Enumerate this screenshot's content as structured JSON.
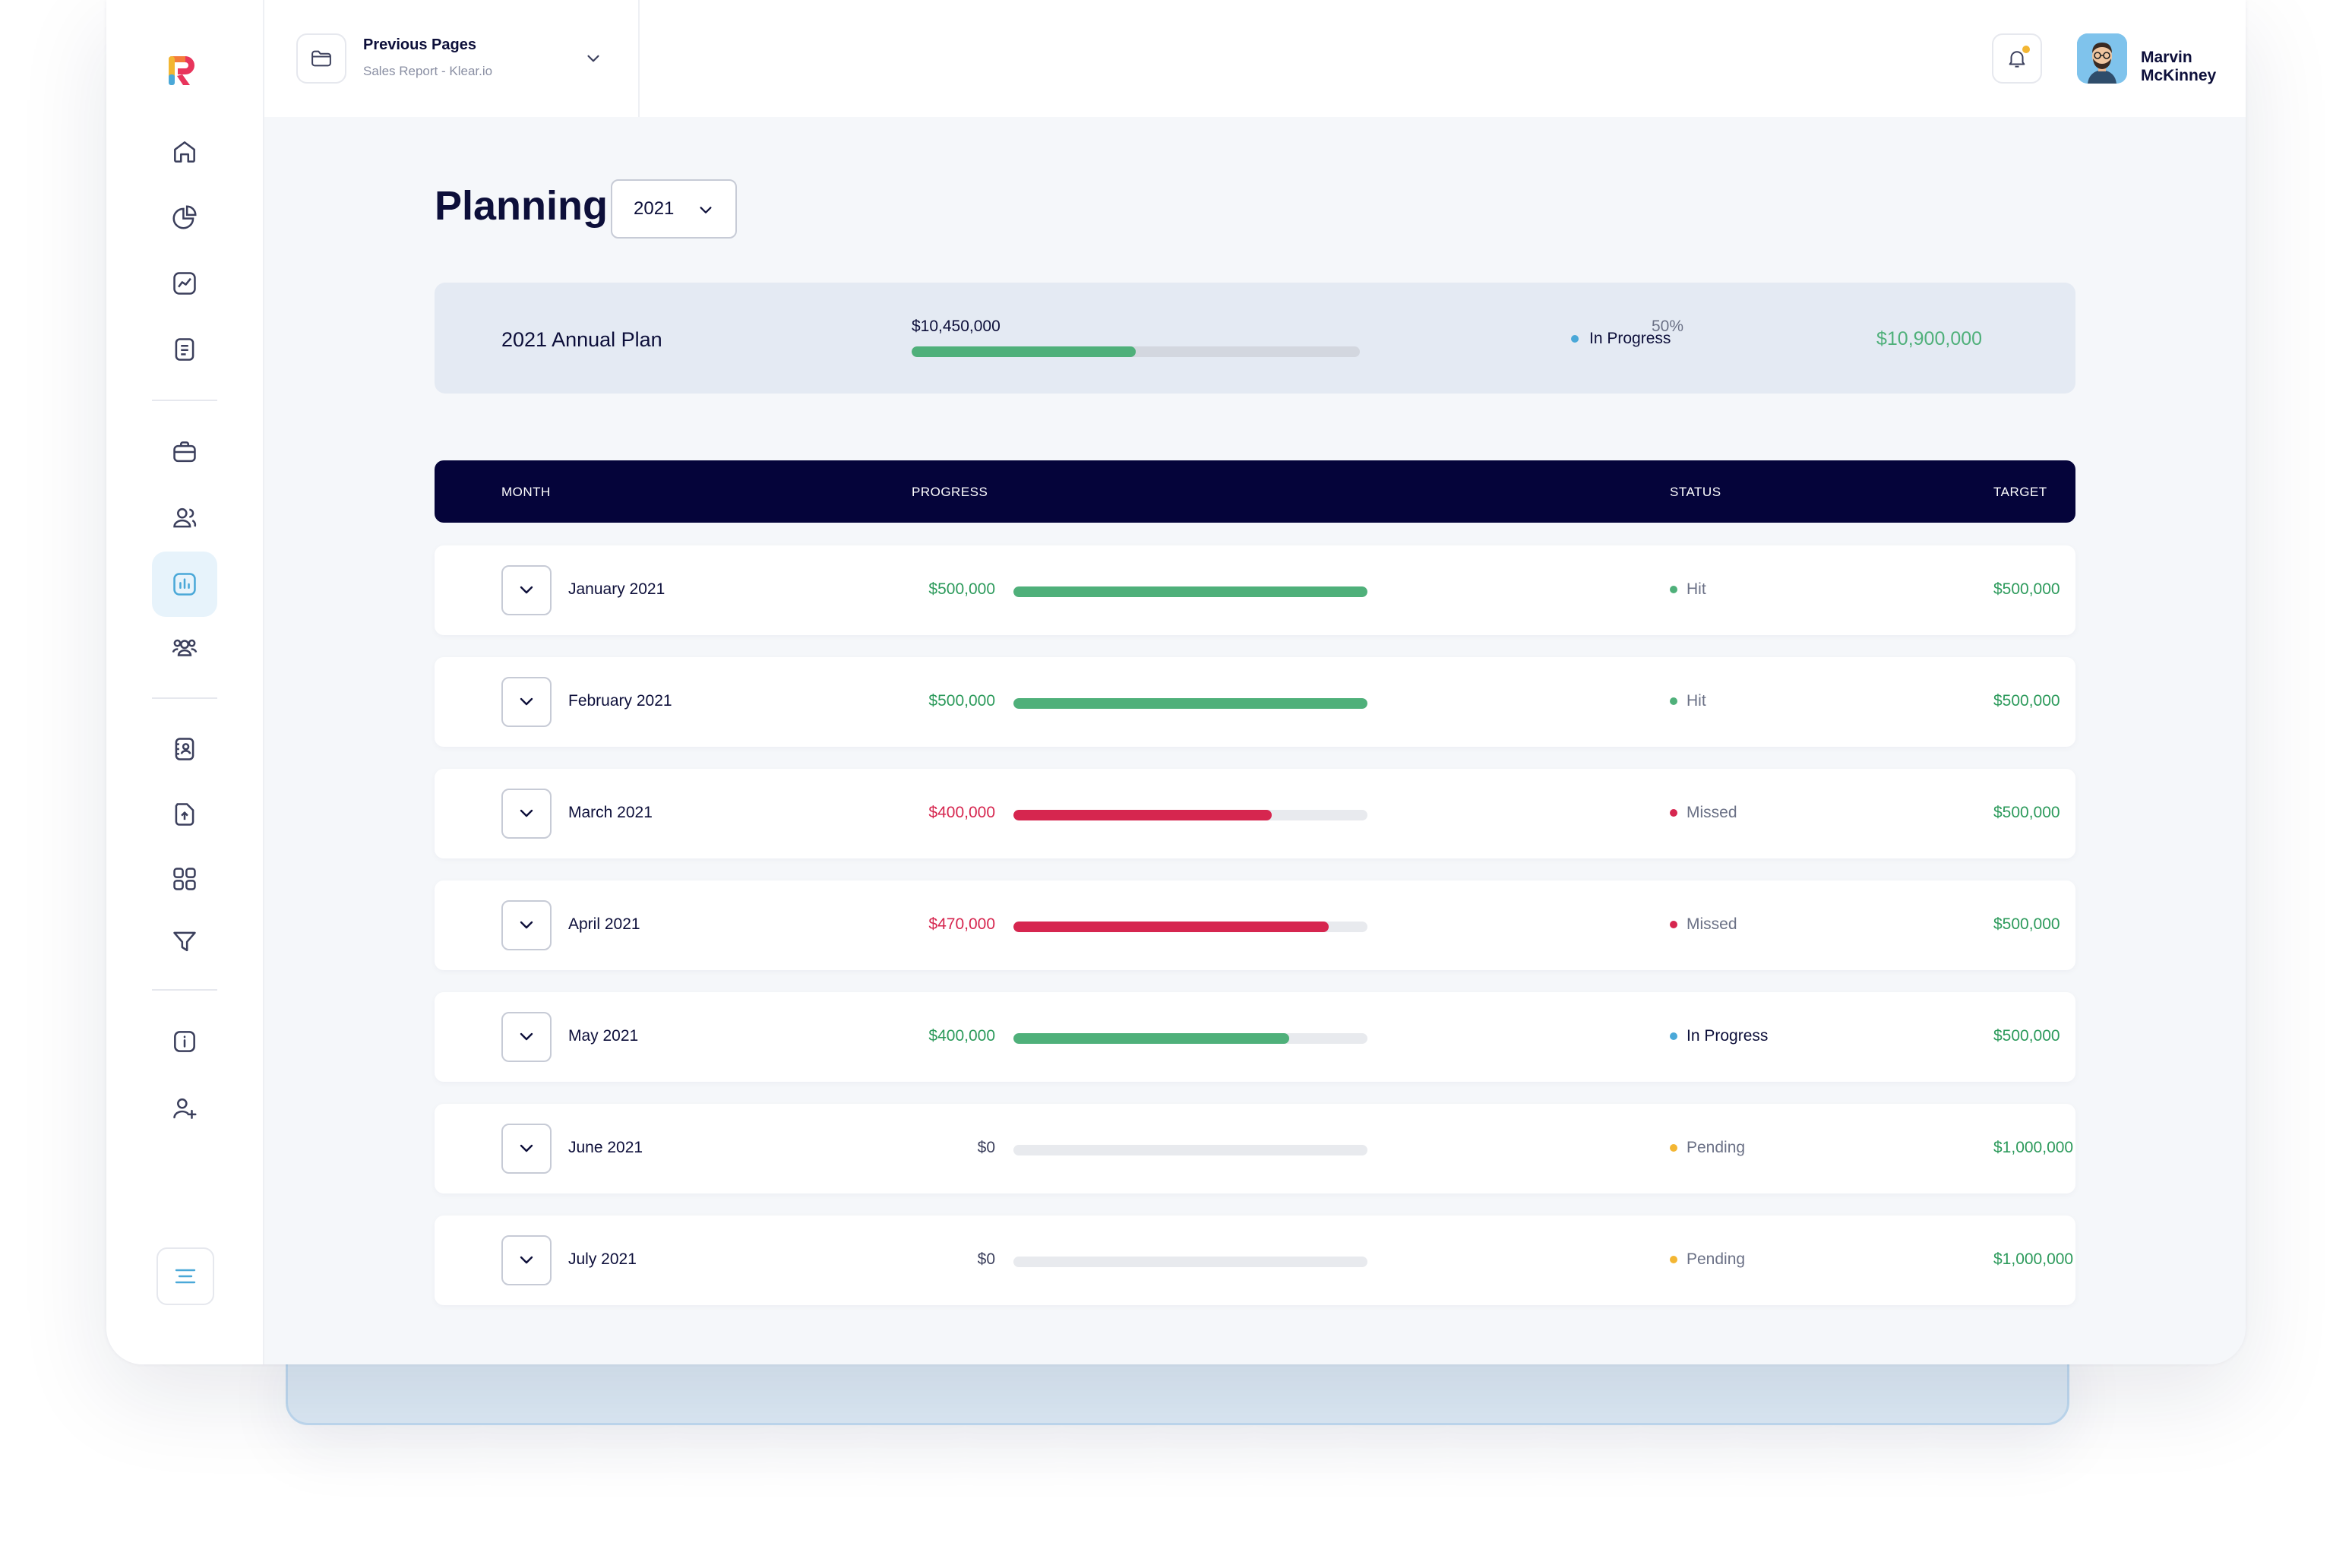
{
  "topbar": {
    "prev_title": "Previous Pages",
    "prev_subtitle": "Sales Report - Klear.io",
    "user_name": "Marvin McKinney"
  },
  "page": {
    "title": "Planning",
    "year": "2021"
  },
  "annual": {
    "title": "2021 Annual Plan",
    "amount": "$10,450,000",
    "percent_label": "50%",
    "progress": 0.5,
    "status": "In Progress",
    "status_color": "#4aa8d8",
    "target": "$10,900,000"
  },
  "table": {
    "headers": {
      "month": "MONTH",
      "progress": "PROGRESS",
      "status": "STATUS",
      "target": "TARGET"
    },
    "rows": [
      {
        "month": "January 2021",
        "amount": "$500,000",
        "amount_color": "#2c9a5b",
        "progress": 1.0,
        "bar_color": "#4fb07a",
        "status": "Hit",
        "status_color": "#4fb07a",
        "status_text_color": "#6b7186",
        "target": "$500,000"
      },
      {
        "month": "February 2021",
        "amount": "$500,000",
        "amount_color": "#2c9a5b",
        "progress": 1.0,
        "bar_color": "#4fb07a",
        "status": "Hit",
        "status_color": "#4fb07a",
        "status_text_color": "#6b7186",
        "target": "$500,000"
      },
      {
        "month": "March 2021",
        "amount": "$400,000",
        "amount_color": "#d6264f",
        "progress": 0.73,
        "bar_color": "#d6264f",
        "status": "Missed",
        "status_color": "#d6264f",
        "status_text_color": "#6b7186",
        "target": "$500,000"
      },
      {
        "month": "April 2021",
        "amount": "$470,000",
        "amount_color": "#d6264f",
        "progress": 0.89,
        "bar_color": "#d6264f",
        "status": "Missed",
        "status_color": "#d6264f",
        "status_text_color": "#6b7186",
        "target": "$500,000"
      },
      {
        "month": "May 2021",
        "amount": "$400,000",
        "amount_color": "#2c9a5b",
        "progress": 0.78,
        "bar_color": "#4fb07a",
        "status": "In Progress",
        "status_color": "#4aa8d8",
        "status_text_color": "#0d0f3a",
        "target": "$500,000"
      },
      {
        "month": "June 2021",
        "amount": "$0",
        "amount_color": "#3b3f5c",
        "progress": 0,
        "bar_color": "#4fb07a",
        "status": "Pending",
        "status_color": "#f3b633",
        "status_text_color": "#6b7186",
        "target": "$1,000,000"
      },
      {
        "month": "July 2021",
        "amount": "$0",
        "amount_color": "#3b3f5c",
        "progress": 0,
        "bar_color": "#4fb07a",
        "status": "Pending",
        "status_color": "#f3b633",
        "status_text_color": "#6b7186",
        "target": "$1,000,000"
      }
    ]
  },
  "sidebar": {
    "icons": [
      "home-icon",
      "pie-chart-icon",
      "trend-chart-icon",
      "document-icon",
      "briefcase-icon",
      "users-icon",
      "bar-chart-icon",
      "team-icon",
      "contact-book-icon",
      "upload-file-icon",
      "grid-apps-icon",
      "filter-icon",
      "info-icon",
      "add-user-icon"
    ],
    "active": "bar-chart-icon"
  }
}
